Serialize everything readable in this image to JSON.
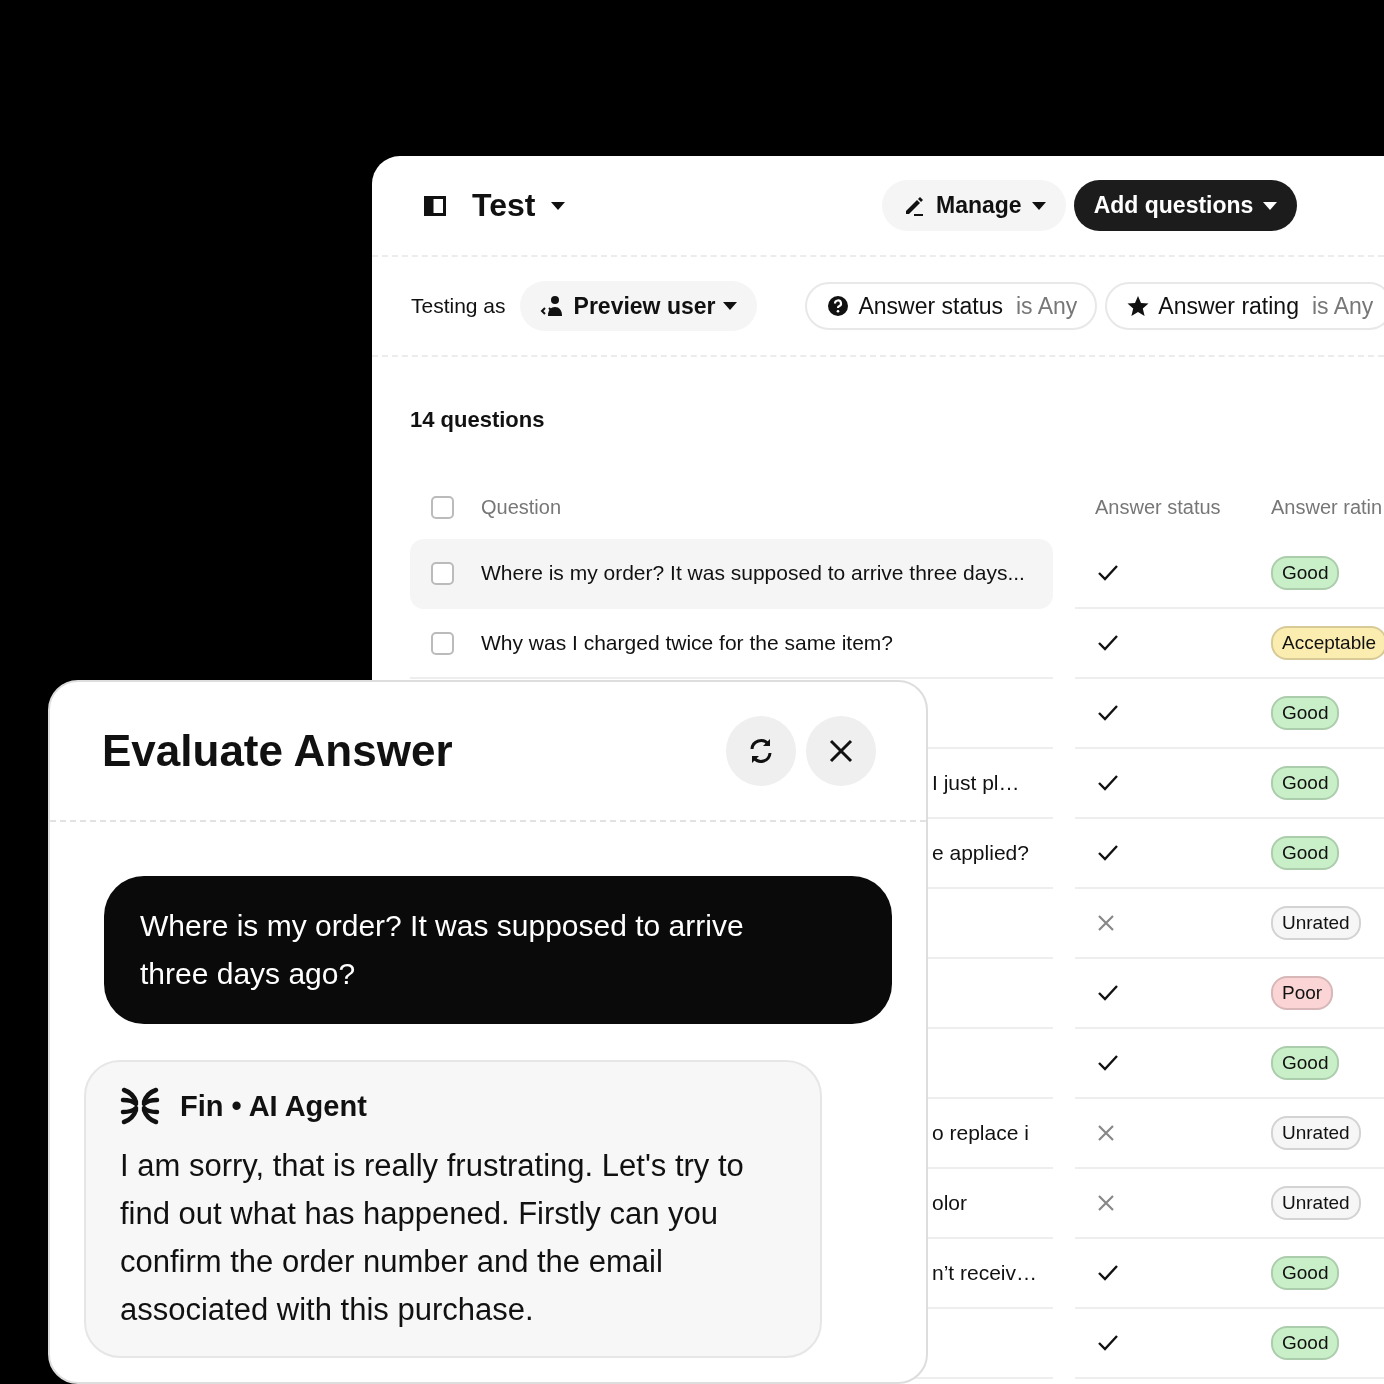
{
  "header": {
    "title": "Test",
    "buttons": [
      {
        "label": "Manage",
        "kind": "secondary"
      },
      {
        "label": "Add questions",
        "kind": "primary"
      }
    ]
  },
  "filters": {
    "label": "Testing as",
    "user": "Preview user",
    "chips": [
      {
        "kind": "status",
        "field": "Answer status",
        "operator": "is Any"
      },
      {
        "kind": "rating",
        "field": "Answer rating",
        "operator": "is Any"
      }
    ]
  },
  "count": "14 questions",
  "table": {
    "select_all": {
      "checked": false
    },
    "columns": [
      "Question",
      "Answer status",
      "Answer ratin"
    ],
    "rows": [
      {
        "kind": "hovered",
        "checked": false,
        "question": "Where is my order? It was supposed to arrive three days...",
        "answered": true,
        "rating": "Good",
        "color": "#c9efc9"
      },
      {
        "kind": "full",
        "checked": false,
        "question": "Why was I charged twice for the same item?",
        "answered": true,
        "rating": "Acceptable",
        "color": "#fbecb0"
      },
      {
        "kind": "covered",
        "answered": true,
        "rating": "Good",
        "color": "#c9efc9"
      },
      {
        "kind": "covered",
        "question": "I just pl…",
        "answered": true,
        "rating": "Good",
        "color": "#c9efc9"
      },
      {
        "kind": "covered",
        "question": "e applied?",
        "answered": true,
        "rating": "Good",
        "color": "#c9efc9"
      },
      {
        "kind": "covered",
        "answered": false,
        "rating": "Unrated",
        "color": "#f6f6f6"
      },
      {
        "kind": "covered",
        "answered": true,
        "rating": "Poor",
        "color": "#fbd5d5"
      },
      {
        "kind": "covered",
        "answered": true,
        "rating": "Good",
        "color": "#c9efc9"
      },
      {
        "kind": "covered",
        "question": "o replace i",
        "answered": false,
        "rating": "Unrated",
        "color": "#f6f6f6"
      },
      {
        "kind": "covered",
        "question": "olor",
        "answered": false,
        "rating": "Unrated",
        "color": "#f6f6f6"
      },
      {
        "kind": "covered",
        "question": "n’t receiv…",
        "answered": true,
        "rating": "Good",
        "color": "#c9efc9"
      },
      {
        "kind": "covered",
        "answered": true,
        "rating": "Good",
        "color": "#c9efc9"
      }
    ]
  },
  "dialog": {
    "title": "Evaluate Answer",
    "question": "Where is my order? It was supposed to arrive three days ago?",
    "answer": {
      "agent": "Fin • AI Agent",
      "text": "I am sorry, that is really frustrating. Let's try to find out what has happened. Firstly can you confirm the order number and the email associated with this purchase."
    }
  }
}
